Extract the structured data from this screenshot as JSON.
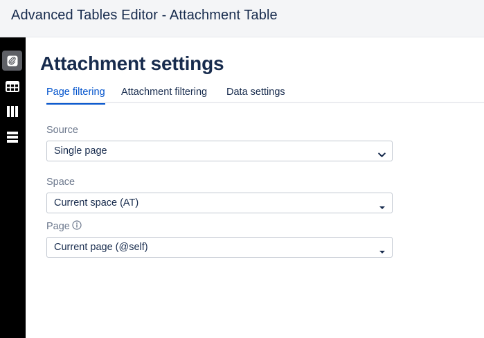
{
  "window": {
    "title": "Advanced Tables Editor - Attachment Table"
  },
  "sidebar": {
    "items": [
      {
        "icon": "attachment-icon",
        "active": true
      },
      {
        "icon": "table-icon",
        "active": false
      },
      {
        "icon": "columns-icon",
        "active": false
      },
      {
        "icon": "rows-icon",
        "active": false
      }
    ]
  },
  "main": {
    "title": "Attachment settings",
    "tabs": [
      {
        "label": "Page filtering",
        "active": true
      },
      {
        "label": "Attachment filtering",
        "active": false
      },
      {
        "label": "Data settings",
        "active": false
      }
    ],
    "fields": {
      "source": {
        "label": "Source",
        "value": "Single page"
      },
      "space": {
        "label": "Space",
        "value": "Current space (AT)"
      },
      "page": {
        "label": "Page",
        "value": "Current page (@self)",
        "info_icon": "info-icon"
      }
    }
  },
  "colors": {
    "accent": "#0052cc",
    "sidebar": "#000000",
    "text": "#172b4d",
    "muted": "#6b778c"
  }
}
